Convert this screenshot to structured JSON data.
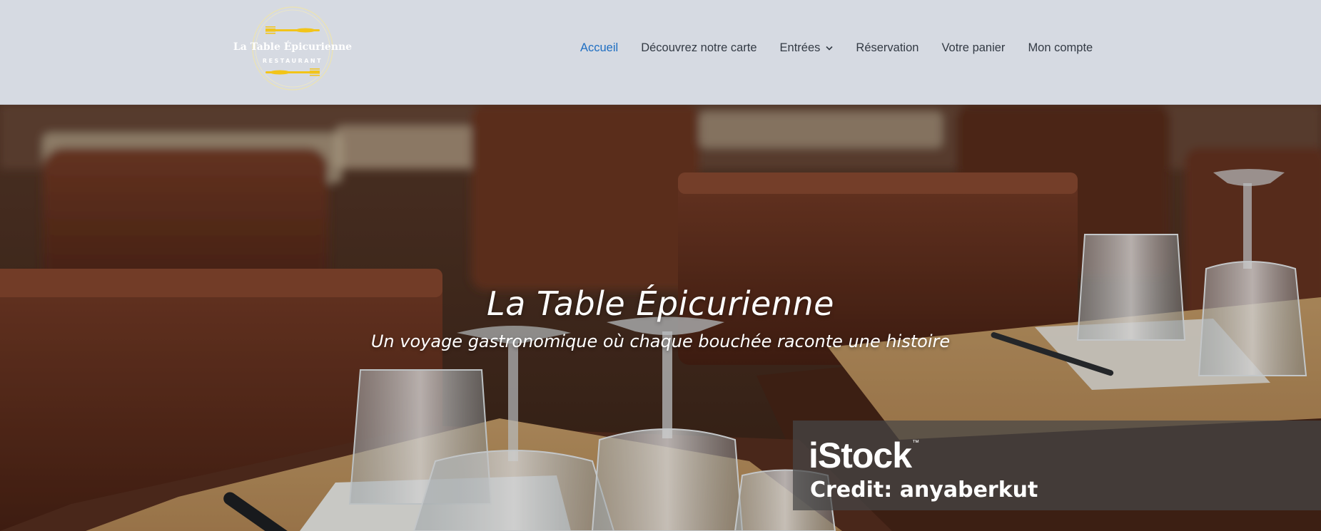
{
  "logo": {
    "name": "La Table Épicurienne",
    "tagline": "RESTAURANT",
    "accent_color": "#f2c419"
  },
  "nav": {
    "items": [
      {
        "label": "Accueil",
        "active": true
      },
      {
        "label": "Découvrez notre carte"
      },
      {
        "label": "Entrées",
        "has_dropdown": true,
        "icon": "chevron-down-icon"
      },
      {
        "label": "Réservation"
      },
      {
        "label": "Votre panier"
      },
      {
        "label": "Mon compte"
      }
    ],
    "active_color": "#1e6ec2"
  },
  "hero": {
    "title": "La Table Épicurienne",
    "subtitle": "Un voyage gastronomique où chaque bouchée raconte une histoire",
    "watermark": {
      "brand": "iStock",
      "trademark": "™",
      "credit": "Credit: anyaberkut"
    }
  }
}
